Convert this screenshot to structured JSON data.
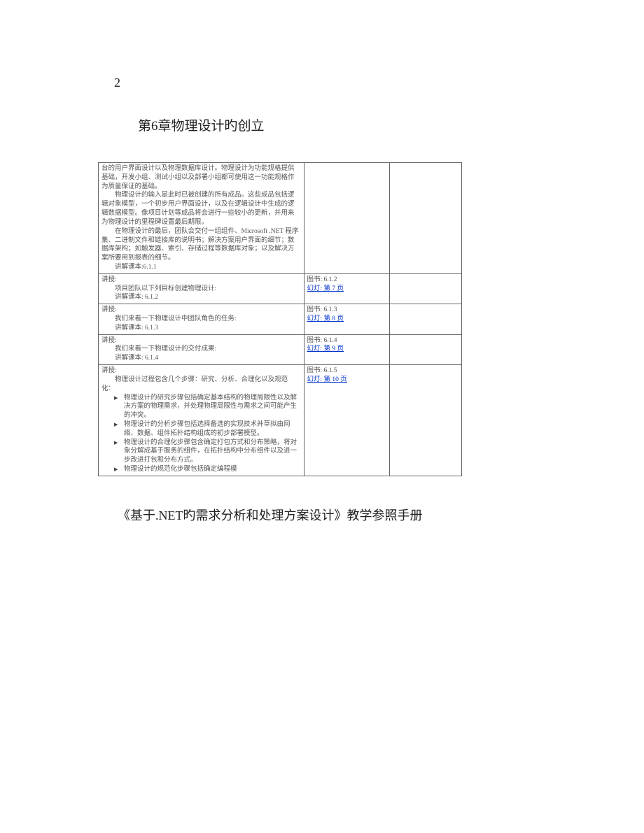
{
  "page_number": "2",
  "chapter_title": "第6章物理设计旳创立",
  "row0": {
    "p1": "台的用户界面设计以及物理数据库设计。物理设计为功能规格提供基础，开发小组、测试小组以及部署小组都可使用这一功能规格作为质量保证的基础。",
    "p2": "物理设计的输入是此时已被创建的所有成品。这些成品包括逻辑对象模型，一个初步用户界面设计，以及在逻辑设计中生成的逻辑数据模型。像项目计划等成品将会进行一些较小的更新，并用来为物理设计的里程碑设置最后期限。",
    "p3": "在物理设计的最后，团队会交付一组组件、Microsoft .NET 程序集、二进制文件和链接库的说明书；解决方案用户界面的细节；数据库架构；如触发器、索引、存储过程等数据库对象；以及解决方案所要用到报表的细节。",
    "p4": "讲解课本:6.1.1"
  },
  "row1": {
    "head": "讲授:",
    "p1": "项目团队以下列目标创建物理设计:",
    "p2": "讲解课本: 6.1.2",
    "ref1": "图书: 6.1.2",
    "ref2": "幻灯: 第 7 页"
  },
  "row2": {
    "head": "讲授:",
    "p1": "我们来看一下物理设计中团队角色的任务:",
    "p2": "讲解课本: 6.1.3",
    "ref1": "图书: 6.1.3",
    "ref2": "幻灯: 第 8 页"
  },
  "row3": {
    "head": "讲授:",
    "p1": "我们来看一下物理设计的交付成果:",
    "p2": "讲解课本: 6.1.4",
    "ref1": "图书: 6.1.4",
    "ref2": "幻灯: 第 9 页"
  },
  "row4": {
    "head": "讲授:",
    "p1": "物理设计过程包含几个步骤：研究、分析、合理化以及规范化：",
    "b1": "物理设计的研究步骤包括确定基本结构的物理局限性以及解决方案的物理需求，并处理物理局限性与需求之间可能产生的冲突。",
    "b2": "物理设计的分析步骤包括选择备选的实现技术并草拟由网络、数据、组件拓扑结构组成的初步部署模型。",
    "b3": "物理设计的合理化步骤包含确定打包方式和分布策略，将对象分解成基于服务的组件，在拓扑结构中分布组件以及进一步改进打包和分布方式。",
    "b4": "物理设计的规范化步骤包括确定编程模",
    "ref1": "图书: 6.1.5",
    "ref2": "幻灯: 第 10 页"
  },
  "footer_title": "《基于.NET旳需求分析和处理方案设计》教学参照手册"
}
